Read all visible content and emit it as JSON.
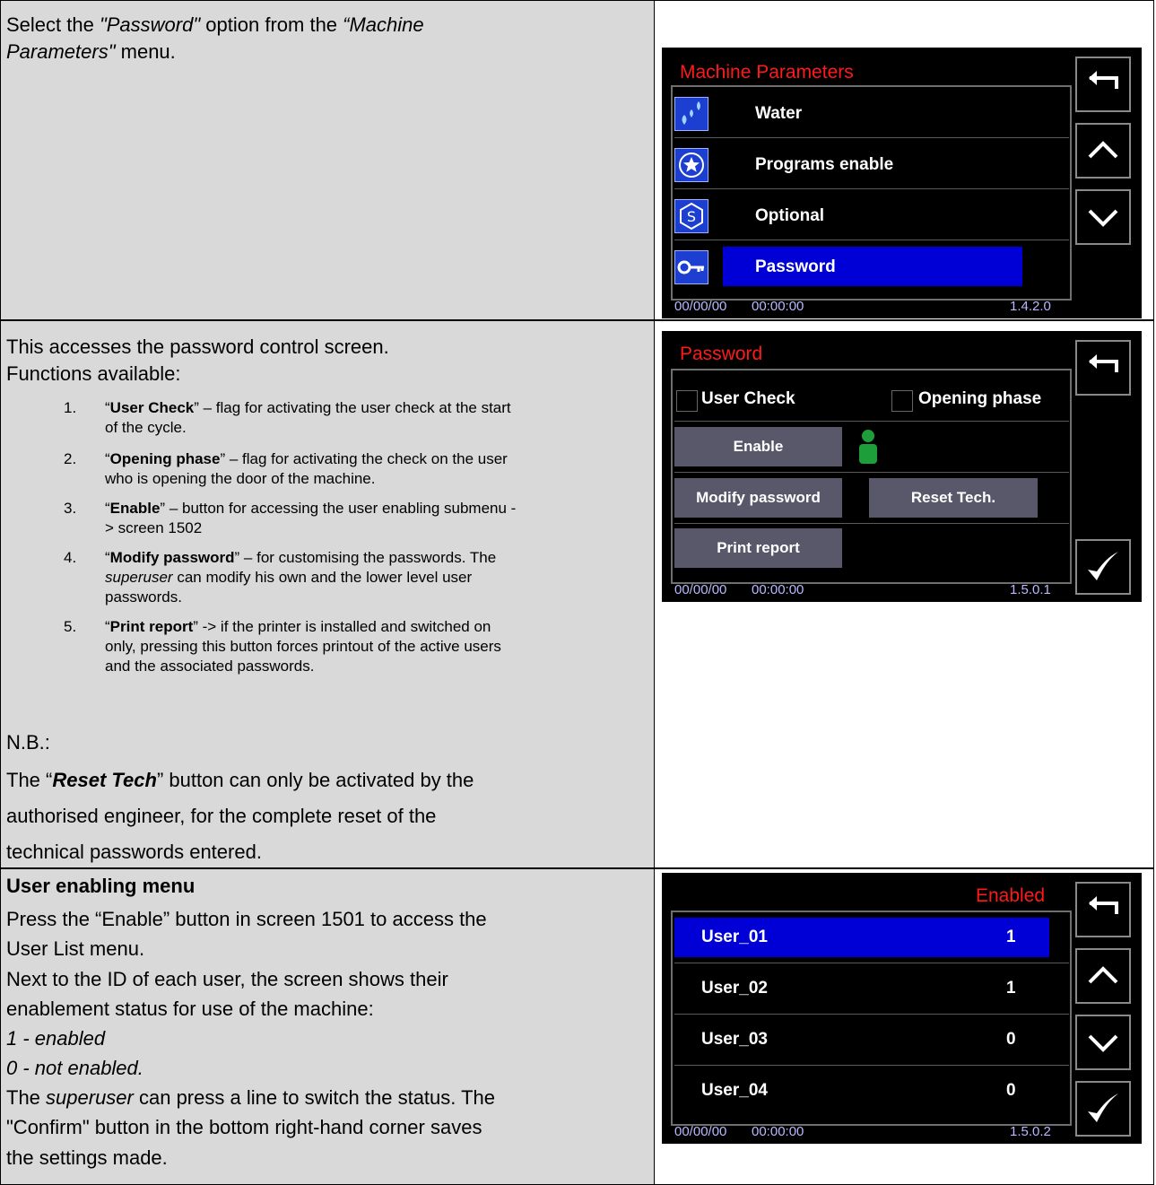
{
  "row1": {
    "intro_prefix": "Select the ",
    "intro_option": "\"Password\"",
    "intro_mid": " option from the ",
    "intro_menu_line1": "“Machine",
    "intro_menu_line2": "Parameters\"",
    "intro_suffix": " menu."
  },
  "screen1": {
    "title": "Machine Parameters",
    "items": [
      {
        "label": "Water",
        "icon": "water-drops-icon"
      },
      {
        "label": "Programs enable",
        "icon": "star-circle-icon"
      },
      {
        "label": "Optional",
        "icon": "s-badge-icon"
      },
      {
        "label": "Password",
        "icon": "key-icon"
      }
    ],
    "date": "00/00/00",
    "time": "00:00:00",
    "version": "1.4.2.0"
  },
  "row2": {
    "line1": "This accesses the password control screen.",
    "line2": "Functions available:",
    "items": [
      {
        "num": "1.",
        "key": "User Check",
        "text1": "– flag for activating the user check at the start",
        "text2": "of the cycle."
      },
      {
        "num": "2.",
        "key": "Opening phase",
        "text1": "– flag for activating the check on the user",
        "text2": "who is opening the door of the machine."
      },
      {
        "num": "3.",
        "key": "Enable",
        "text1": "– button for accessing the user enabling submenu -",
        "text2": "> screen 1502"
      },
      {
        "num": "4.",
        "key": "Modify password",
        "text1": "– for customising the passwords. The",
        "text2_em": "superuser",
        "text2": " can modify his own and the lower level user",
        "text3": "passwords."
      },
      {
        "num": "5.",
        "key": "Print report",
        "text1": "-> if the printer is installed and switched on",
        "text2": "only, pressing this button forces printout of the active users",
        "text3": "and the associated passwords."
      }
    ],
    "nb_label": "N.B.:",
    "nb_pre": "The “",
    "nb_key": "Reset Tech",
    "nb_post": "” button can only be activated by the",
    "nb_line2": "authorised engineer, for the complete reset of the",
    "nb_line3": "technical passwords entered."
  },
  "screen2": {
    "title": "Password",
    "user_check": "User Check",
    "opening_phase": "Opening phase",
    "enable": "Enable",
    "modify_password": "Modify password",
    "reset_tech": "Reset Tech.",
    "print_report": "Print report",
    "date": "00/00/00",
    "time": "00:00:00",
    "version": "1.5.0.1"
  },
  "row3": {
    "heading": "User enabling menu",
    "line1": "Press the “Enable” button in screen 1501 to access the",
    "line2": "User List menu.",
    "line3": "Next to the ID of each user, the screen shows their",
    "line4": "enablement status for use of the machine:",
    "line5": "1 - enabled",
    "line6": "0 - not enabled.",
    "line7_pre": "The ",
    "line7_em": "superuser",
    "line7_post": " can press a line to switch the status. The",
    "line8": "\"Confirm\" button in the bottom right-hand corner saves",
    "line9": "the settings made."
  },
  "screen3": {
    "title": "Enabled",
    "users": [
      {
        "name": "User_01",
        "value": "1"
      },
      {
        "name": "User_02",
        "value": "1"
      },
      {
        "name": "User_03",
        "value": "0"
      },
      {
        "name": "User_04",
        "value": "0"
      }
    ],
    "date": "00/00/00",
    "time": "00:00:00",
    "version": "1.5.0.2"
  },
  "colors": {
    "accent_red": "#ff1a1a",
    "selection_blue": "#0000d6",
    "cell_gray": "#d9d9d9",
    "button_gray": "#58586a",
    "user_icon_green": "#1e9e3a"
  }
}
